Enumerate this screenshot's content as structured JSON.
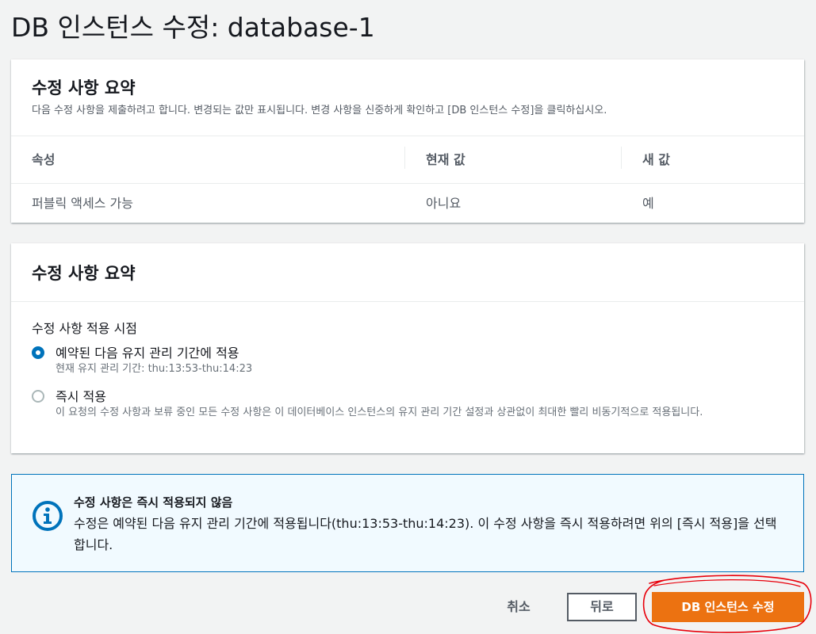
{
  "page": {
    "title": "DB 인스턴스 수정: database-1"
  },
  "summary": {
    "title": "수정 사항 요약",
    "description": "다음 수정 사항을 제출하려고 합니다. 변경되는 값만 표시됩니다. 변경 사항을 신중하게 확인하고 [DB 인스턴스 수정]을 클릭하십시오.",
    "columns": [
      "속성",
      "현재 값",
      "새 값"
    ],
    "rows": [
      {
        "attribute": "퍼블릭 액세스 가능",
        "current": "아니요",
        "new": "예"
      }
    ]
  },
  "schedule": {
    "title": "수정 사항 요약",
    "field_label": "수정 사항 적용 시점",
    "options": [
      {
        "label": "예약된 다음 유지 관리 기간에 적용",
        "description": "현재 유지 관리 기간: thu:13:53-thu:14:23",
        "selected": true
      },
      {
        "label": "즉시 적용",
        "description": "이 요청의 수정 사항과 보류 중인 모든 수정 사항은 이 데이터베이스 인스턴스의 유지 관리 기간 설정과 상관없이 최대한 빨리 비동기적으로 적용됩니다.",
        "selected": false
      }
    ]
  },
  "alert": {
    "icon": "info-icon",
    "title": "수정 사항은 즉시 적용되지 않음",
    "body": "수정은 예약된 다음 유지 관리 기간에 적용됩니다(thu:13:53-thu:14:23). 이 수정 사항을 즉시 적용하려면 위의 [즉시 적용]을 선택합니다."
  },
  "footer": {
    "cancel_label": "취소",
    "back_label": "뒤로",
    "submit_label": "DB 인스턴스 수정"
  },
  "colors": {
    "accent": "#0073bb",
    "primary_button": "#ec7211",
    "annotation": "#e8000b"
  }
}
